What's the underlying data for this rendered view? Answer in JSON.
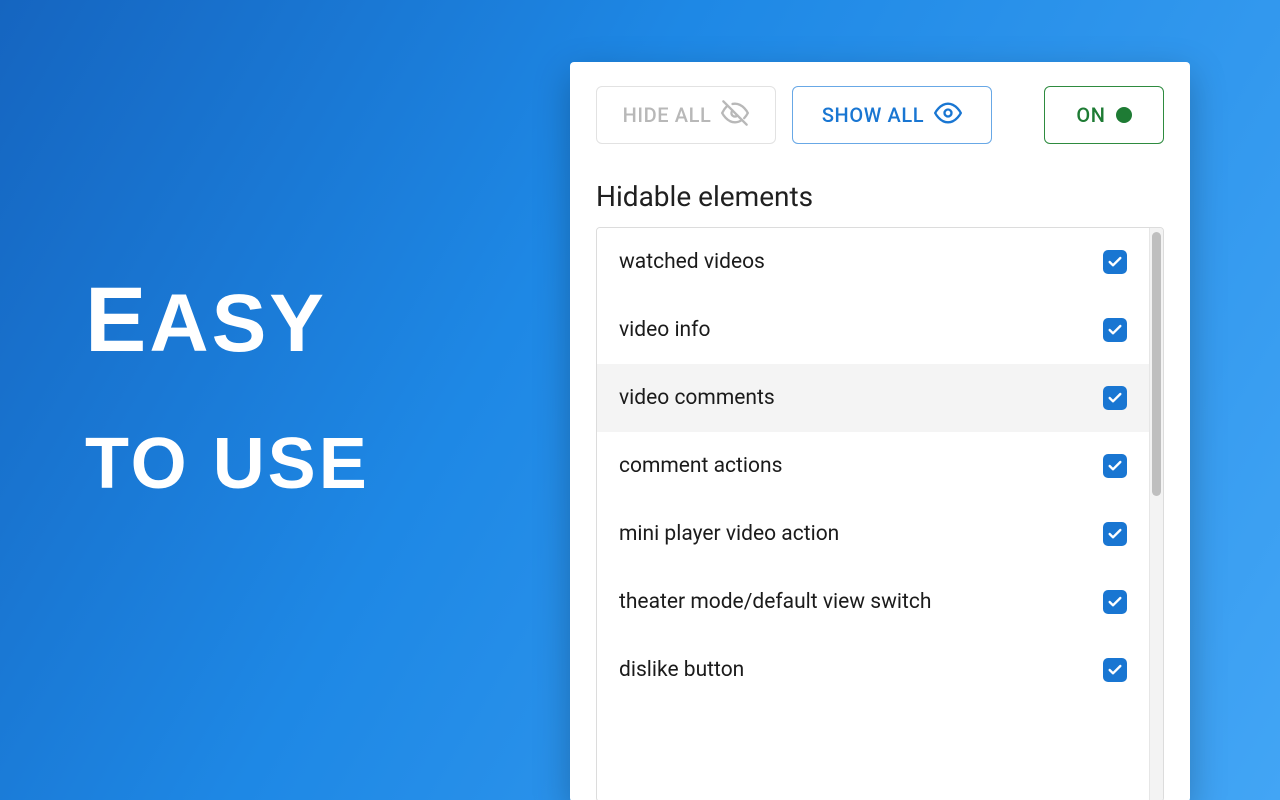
{
  "headline": {
    "line1": "Easy",
    "line2": "to use"
  },
  "toolbar": {
    "hide_label": "HIDE ALL",
    "show_label": "SHOW ALL",
    "on_label": "ON"
  },
  "section_title": "Hidable elements",
  "elements": [
    {
      "label": "watched videos",
      "checked": true,
      "hover": false
    },
    {
      "label": "video info",
      "checked": true,
      "hover": false
    },
    {
      "label": "video comments",
      "checked": true,
      "hover": true
    },
    {
      "label": "comment actions",
      "checked": true,
      "hover": false
    },
    {
      "label": "mini player video action",
      "checked": true,
      "hover": false
    },
    {
      "label": "theater mode/default view switch",
      "checked": true,
      "hover": false
    },
    {
      "label": "dislike button",
      "checked": true,
      "hover": false
    }
  ],
  "colors": {
    "accent": "#1976d2",
    "on_green": "#1e7b34",
    "muted": "#b8b8b8"
  }
}
